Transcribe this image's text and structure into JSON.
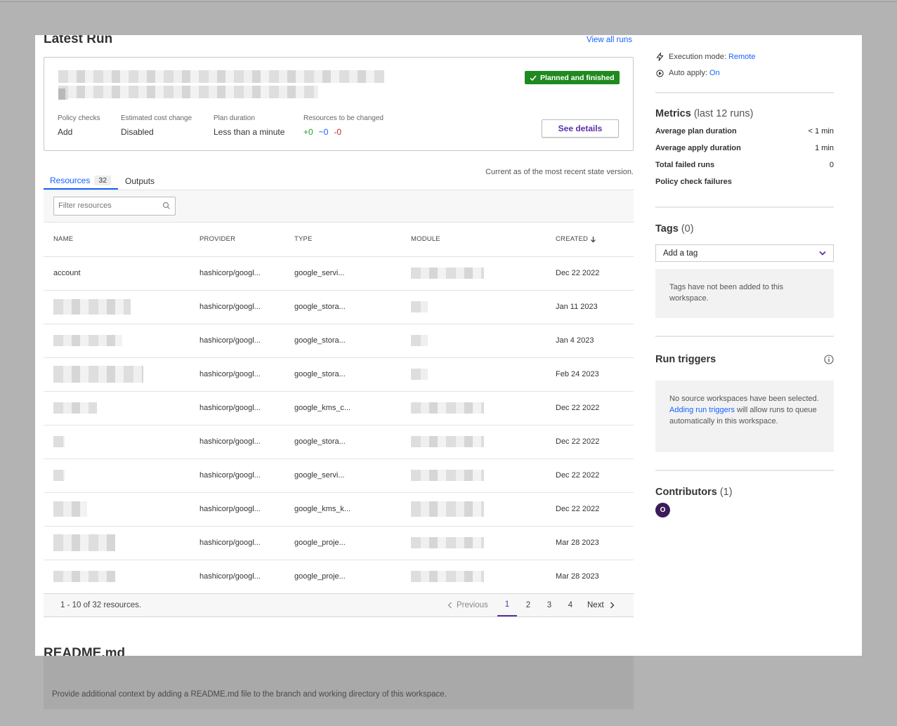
{
  "latest_run": {
    "title": "Latest Run",
    "view_all_link": "View all runs",
    "status_badge": "Planned and finished",
    "see_details": "See details",
    "fields": [
      {
        "label": "Policy checks",
        "value": "Add"
      },
      {
        "label": "Estimated cost change",
        "value": "Disabled"
      },
      {
        "label": "Plan duration",
        "value": "Less than a minute"
      },
      {
        "label": "Resources to be changed",
        "add": "+0",
        "change": "~0",
        "destroy": "-0"
      }
    ]
  },
  "tabs": {
    "resources_label": "Resources",
    "resources_count": "32",
    "outputs_label": "Outputs",
    "state_note": "Current as of the most recent state version."
  },
  "filter": {
    "placeholder": "Filter resources"
  },
  "table": {
    "columns": [
      "NAME",
      "PROVIDER",
      "TYPE",
      "MODULE",
      "CREATED"
    ],
    "rows": [
      {
        "name": "account",
        "provider": "hashicorp/googl...",
        "type": "google_servi...",
        "created": "Dec 22 2022"
      },
      {
        "name": "",
        "provider": "hashicorp/googl...",
        "type": "google_stora...",
        "created": "Jan 11 2023"
      },
      {
        "name": "",
        "provider": "hashicorp/googl...",
        "type": "google_stora...",
        "created": "Jan 4 2023"
      },
      {
        "name": "",
        "provider": "hashicorp/googl...",
        "type": "google_stora...",
        "created": "Feb 24 2023"
      },
      {
        "name": "",
        "provider": "hashicorp/googl...",
        "type": "google_kms_c...",
        "created": "Dec 22 2022"
      },
      {
        "name": "",
        "provider": "hashicorp/googl...",
        "type": "google_stora...",
        "created": "Dec 22 2022"
      },
      {
        "name": "",
        "provider": "hashicorp/googl...",
        "type": "google_servi...",
        "created": "Dec 22 2022"
      },
      {
        "name": "",
        "provider": "hashicorp/googl...",
        "type": "google_kms_k...",
        "created": "Dec 22 2022"
      },
      {
        "name": "",
        "provider": "hashicorp/googl...",
        "type": "google_proje...",
        "created": "Mar 28 2023"
      },
      {
        "name": "",
        "provider": "hashicorp/googl...",
        "type": "google_proje...",
        "created": "Mar 28 2023"
      }
    ]
  },
  "pagination": {
    "summary": "1 - 10 of 32 resources.",
    "previous": "Previous",
    "pages": [
      "1",
      "2",
      "3",
      "4"
    ],
    "next": "Next"
  },
  "readme": {
    "title": "README.md",
    "note": "Provide additional context by adding a README.md file to the branch and working directory of this workspace."
  },
  "sidebar": {
    "execution_mode_label": "Execution mode:",
    "execution_mode_value": "Remote",
    "auto_apply_label": "Auto apply:",
    "auto_apply_value": "On",
    "metrics_title": "Metrics",
    "metrics_sub": "(last 12 runs)",
    "metrics": [
      {
        "label": "Average plan duration",
        "value": "< 1 min"
      },
      {
        "label": "Average apply duration",
        "value": "1 min"
      },
      {
        "label": "Total failed runs",
        "value": "0"
      },
      {
        "label": "Policy check failures",
        "value": ""
      }
    ],
    "tags_title": "Tags",
    "tags_count": "(0)",
    "tags_select": "Add a tag",
    "tags_empty": "Tags have not been added to this workspace.",
    "run_triggers_title": "Run triggers",
    "run_triggers_text_1": "No source workspaces have been selected.",
    "run_triggers_link": "Adding run triggers",
    "run_triggers_text_2": "will allow runs to queue automatically in this workspace.",
    "contributors_title": "Contributors",
    "contributors_count": "(1)",
    "contributor_initial": "O"
  },
  "colors": {
    "link": "#1563ff",
    "badge_green": "#1f8a1f",
    "purple": "#5c2fa8",
    "add": "#2e9e2e",
    "change": "#1563ff",
    "destroy": "#c62828"
  }
}
